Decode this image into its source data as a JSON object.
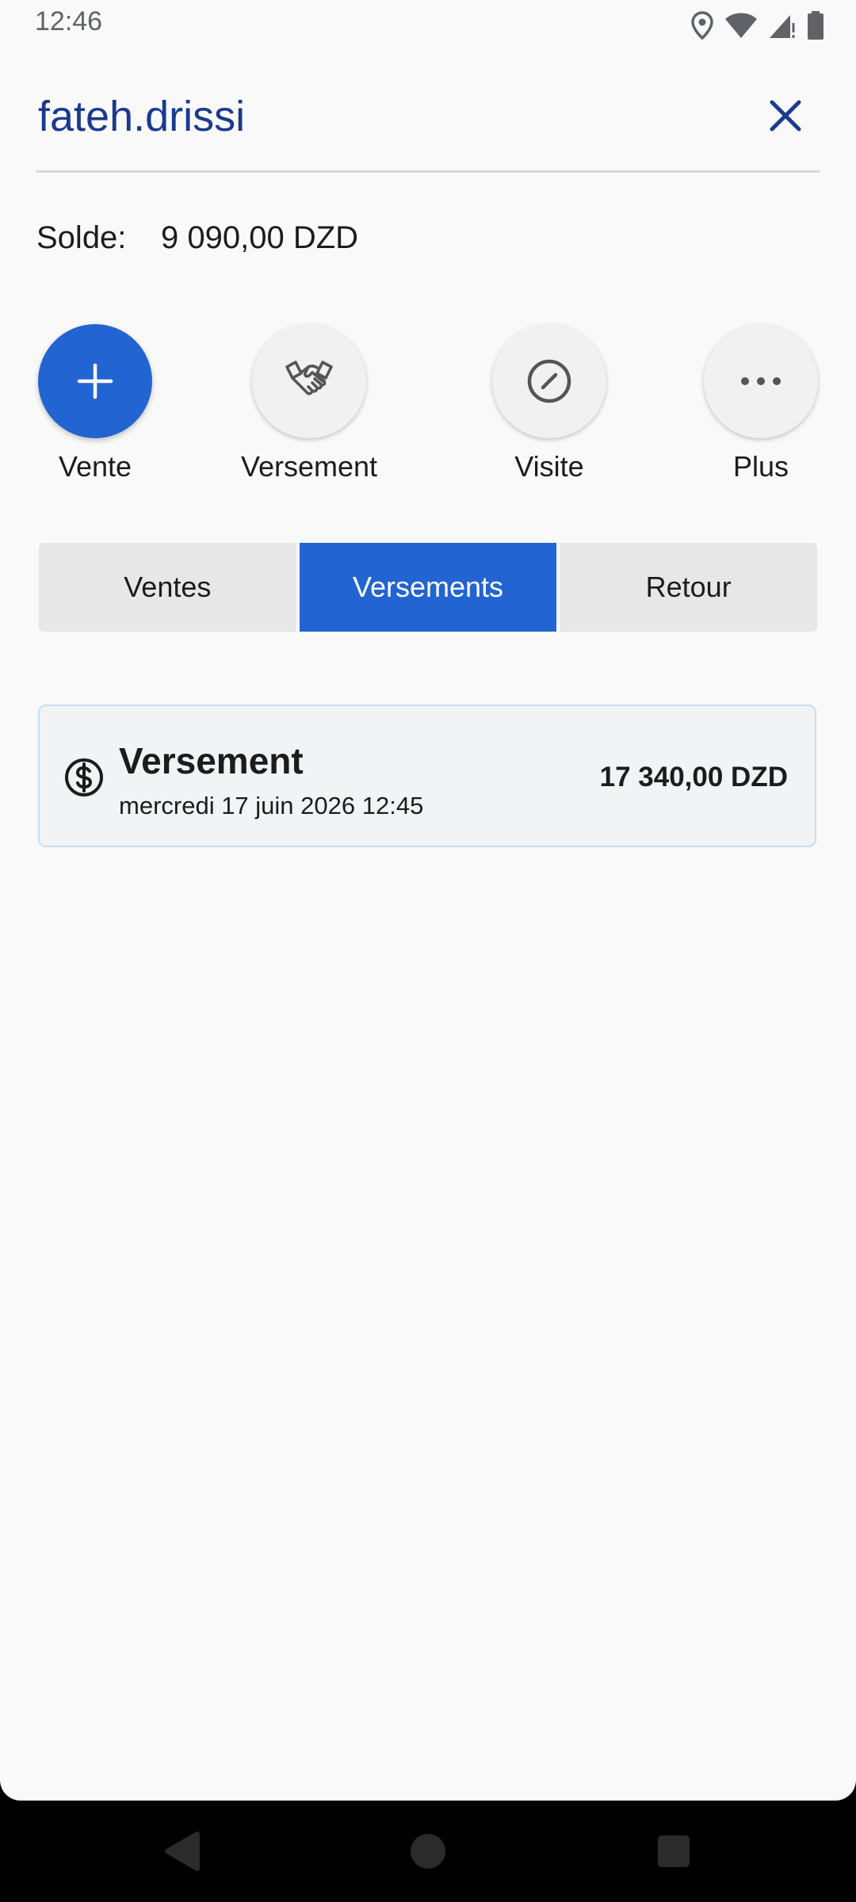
{
  "status_bar": {
    "time": "12:46",
    "icons": [
      "location-icon",
      "wifi-icon",
      "signal-icon",
      "battery-icon"
    ]
  },
  "header": {
    "user_name": "fateh.drissi",
    "close_icon": "close-icon"
  },
  "balance": {
    "label": "Solde:",
    "value": "9 090,00 DZD"
  },
  "actions": [
    {
      "label": "Vente",
      "icon": "plus-icon"
    },
    {
      "label": "Versement",
      "icon": "handshake-icon"
    },
    {
      "label": "Visite",
      "icon": "no-entry-icon"
    },
    {
      "label": "Plus",
      "icon": "more-icon"
    }
  ],
  "tabs": [
    {
      "label": "Ventes",
      "active": false
    },
    {
      "label": "Versements",
      "active": true
    },
    {
      "label": "Retour",
      "active": false
    }
  ],
  "payments": [
    {
      "icon": "dollar-circle-icon",
      "title": "Versement",
      "date": "mercredi 17 juin 2026 12:45",
      "amount": "17 340,00 DZD"
    }
  ],
  "nav_bar": {
    "buttons": [
      "back-icon",
      "home-icon",
      "recents-icon"
    ]
  },
  "colors": {
    "accent": "#2264d1",
    "title": "#1a3a8f",
    "background": "#f9f9f9"
  }
}
